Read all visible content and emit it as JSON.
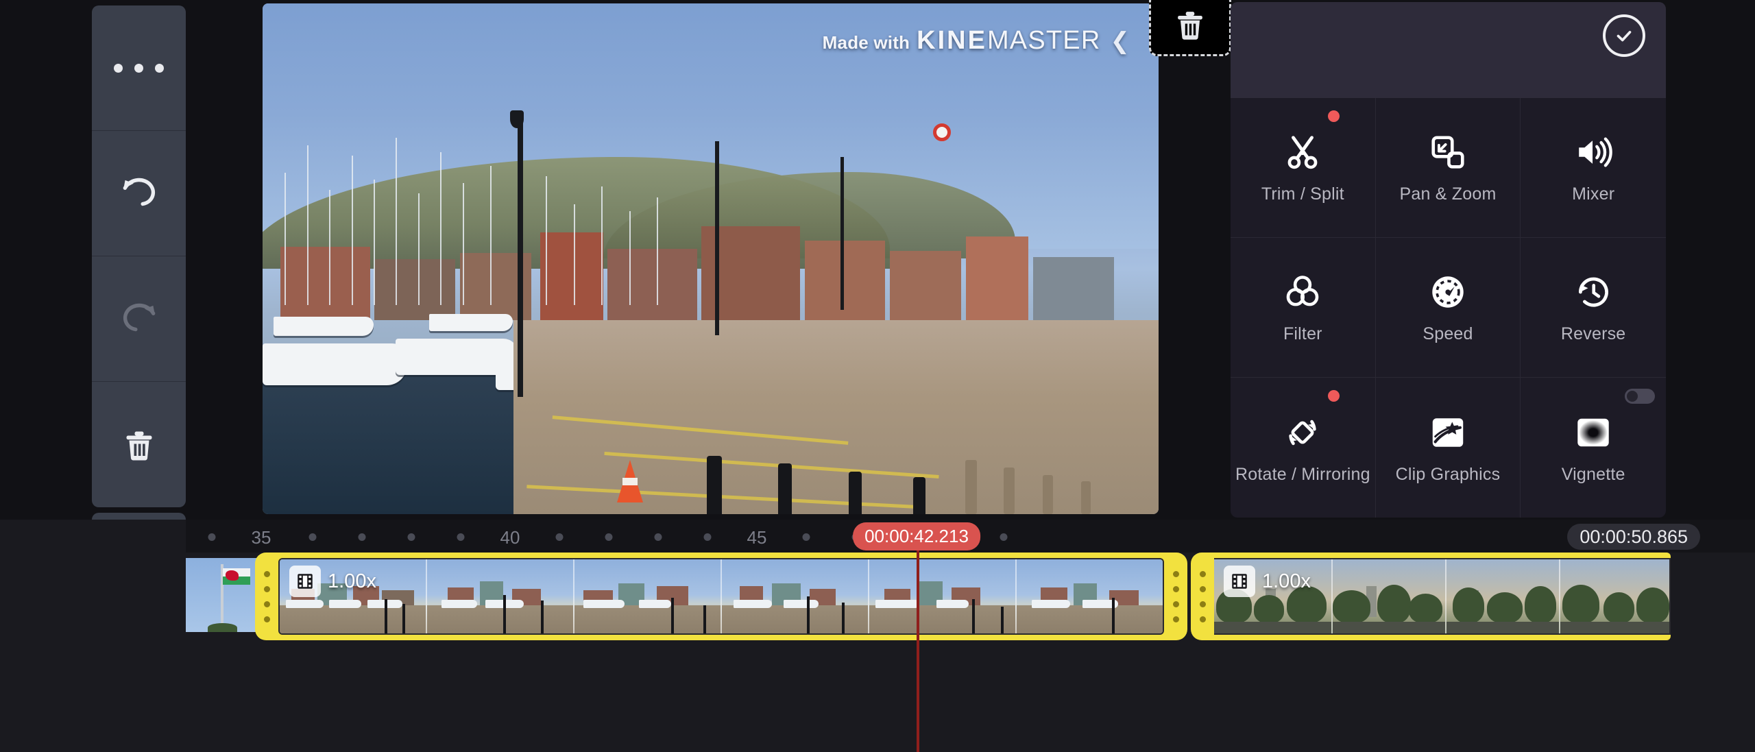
{
  "app": {
    "name": "KineMaster"
  },
  "left_rail": {
    "buttons": [
      {
        "name": "more-options",
        "icon": "ellipsis-icon",
        "enabled": true
      },
      {
        "name": "undo",
        "icon": "undo-icon",
        "enabled": true
      },
      {
        "name": "redo",
        "icon": "redo-icon",
        "enabled": false
      },
      {
        "name": "delete",
        "icon": "trash-icon",
        "enabled": true
      },
      {
        "name": "expand-tracks",
        "icon": "expand-vertical-icon",
        "enabled": true
      },
      {
        "name": "jump-to-end",
        "icon": "arrow-to-rect-icon",
        "enabled": true
      }
    ]
  },
  "preview": {
    "watermark": {
      "made_with": "Made with",
      "brand_bold": "KINE",
      "brand_light": "MASTER",
      "mark": "❮"
    },
    "scene_description": "Marina with moored yachts, brick waterfront apartments, hillside, cobbled quay, traffic cone and bollards"
  },
  "delete_zone": {
    "label": "",
    "icon": "trash-icon"
  },
  "tool_panel": {
    "confirm": {
      "icon": "check-circle-icon",
      "label": ""
    },
    "tools": [
      {
        "label": "Trim / Split",
        "icon": "scissors-icon",
        "badge_new": true,
        "toggle": null
      },
      {
        "label": "Pan & Zoom",
        "icon": "pan-zoom-icon",
        "badge_new": false,
        "toggle": null
      },
      {
        "label": "Mixer",
        "icon": "speaker-icon",
        "badge_new": false,
        "toggle": null
      },
      {
        "label": "Filter",
        "icon": "three-circles-icon",
        "badge_new": false,
        "toggle": null
      },
      {
        "label": "Speed",
        "icon": "speedometer-icon",
        "badge_new": false,
        "toggle": null
      },
      {
        "label": "Reverse",
        "icon": "reverse-clock-icon",
        "badge_new": false,
        "toggle": null
      },
      {
        "label": "Rotate / Mirroring",
        "icon": "rotate-mirror-icon",
        "badge_new": true,
        "toggle": null
      },
      {
        "label": "Clip Graphics",
        "icon": "clip-graphics-icon",
        "badge_new": false,
        "toggle": null
      },
      {
        "label": "Vignette",
        "icon": "vignette-icon",
        "badge_new": false,
        "toggle": "off"
      }
    ]
  },
  "timeline": {
    "playhead_time": "00:00:42.213",
    "total_duration": "00:00:50.865",
    "ruler_labels": [
      "35",
      "40",
      "45"
    ],
    "clips": [
      {
        "name": "clip-previous",
        "selected": false,
        "speed": "",
        "scene": "welsh-flag"
      },
      {
        "name": "clip-selected",
        "selected": true,
        "speed": "1.00x",
        "scene": "marina"
      },
      {
        "name": "clip-next",
        "selected": false,
        "speed": "1.00x",
        "scene": "trees-sunset"
      }
    ]
  },
  "colors": {
    "accent_yellow": "#f2e13f",
    "playhead_red": "#d9534f",
    "badge_red": "#ef5a5a",
    "panel_bg": "#1d1b26",
    "panel_header": "#2e2b3a",
    "rail_bg": "#3a3f4b"
  }
}
